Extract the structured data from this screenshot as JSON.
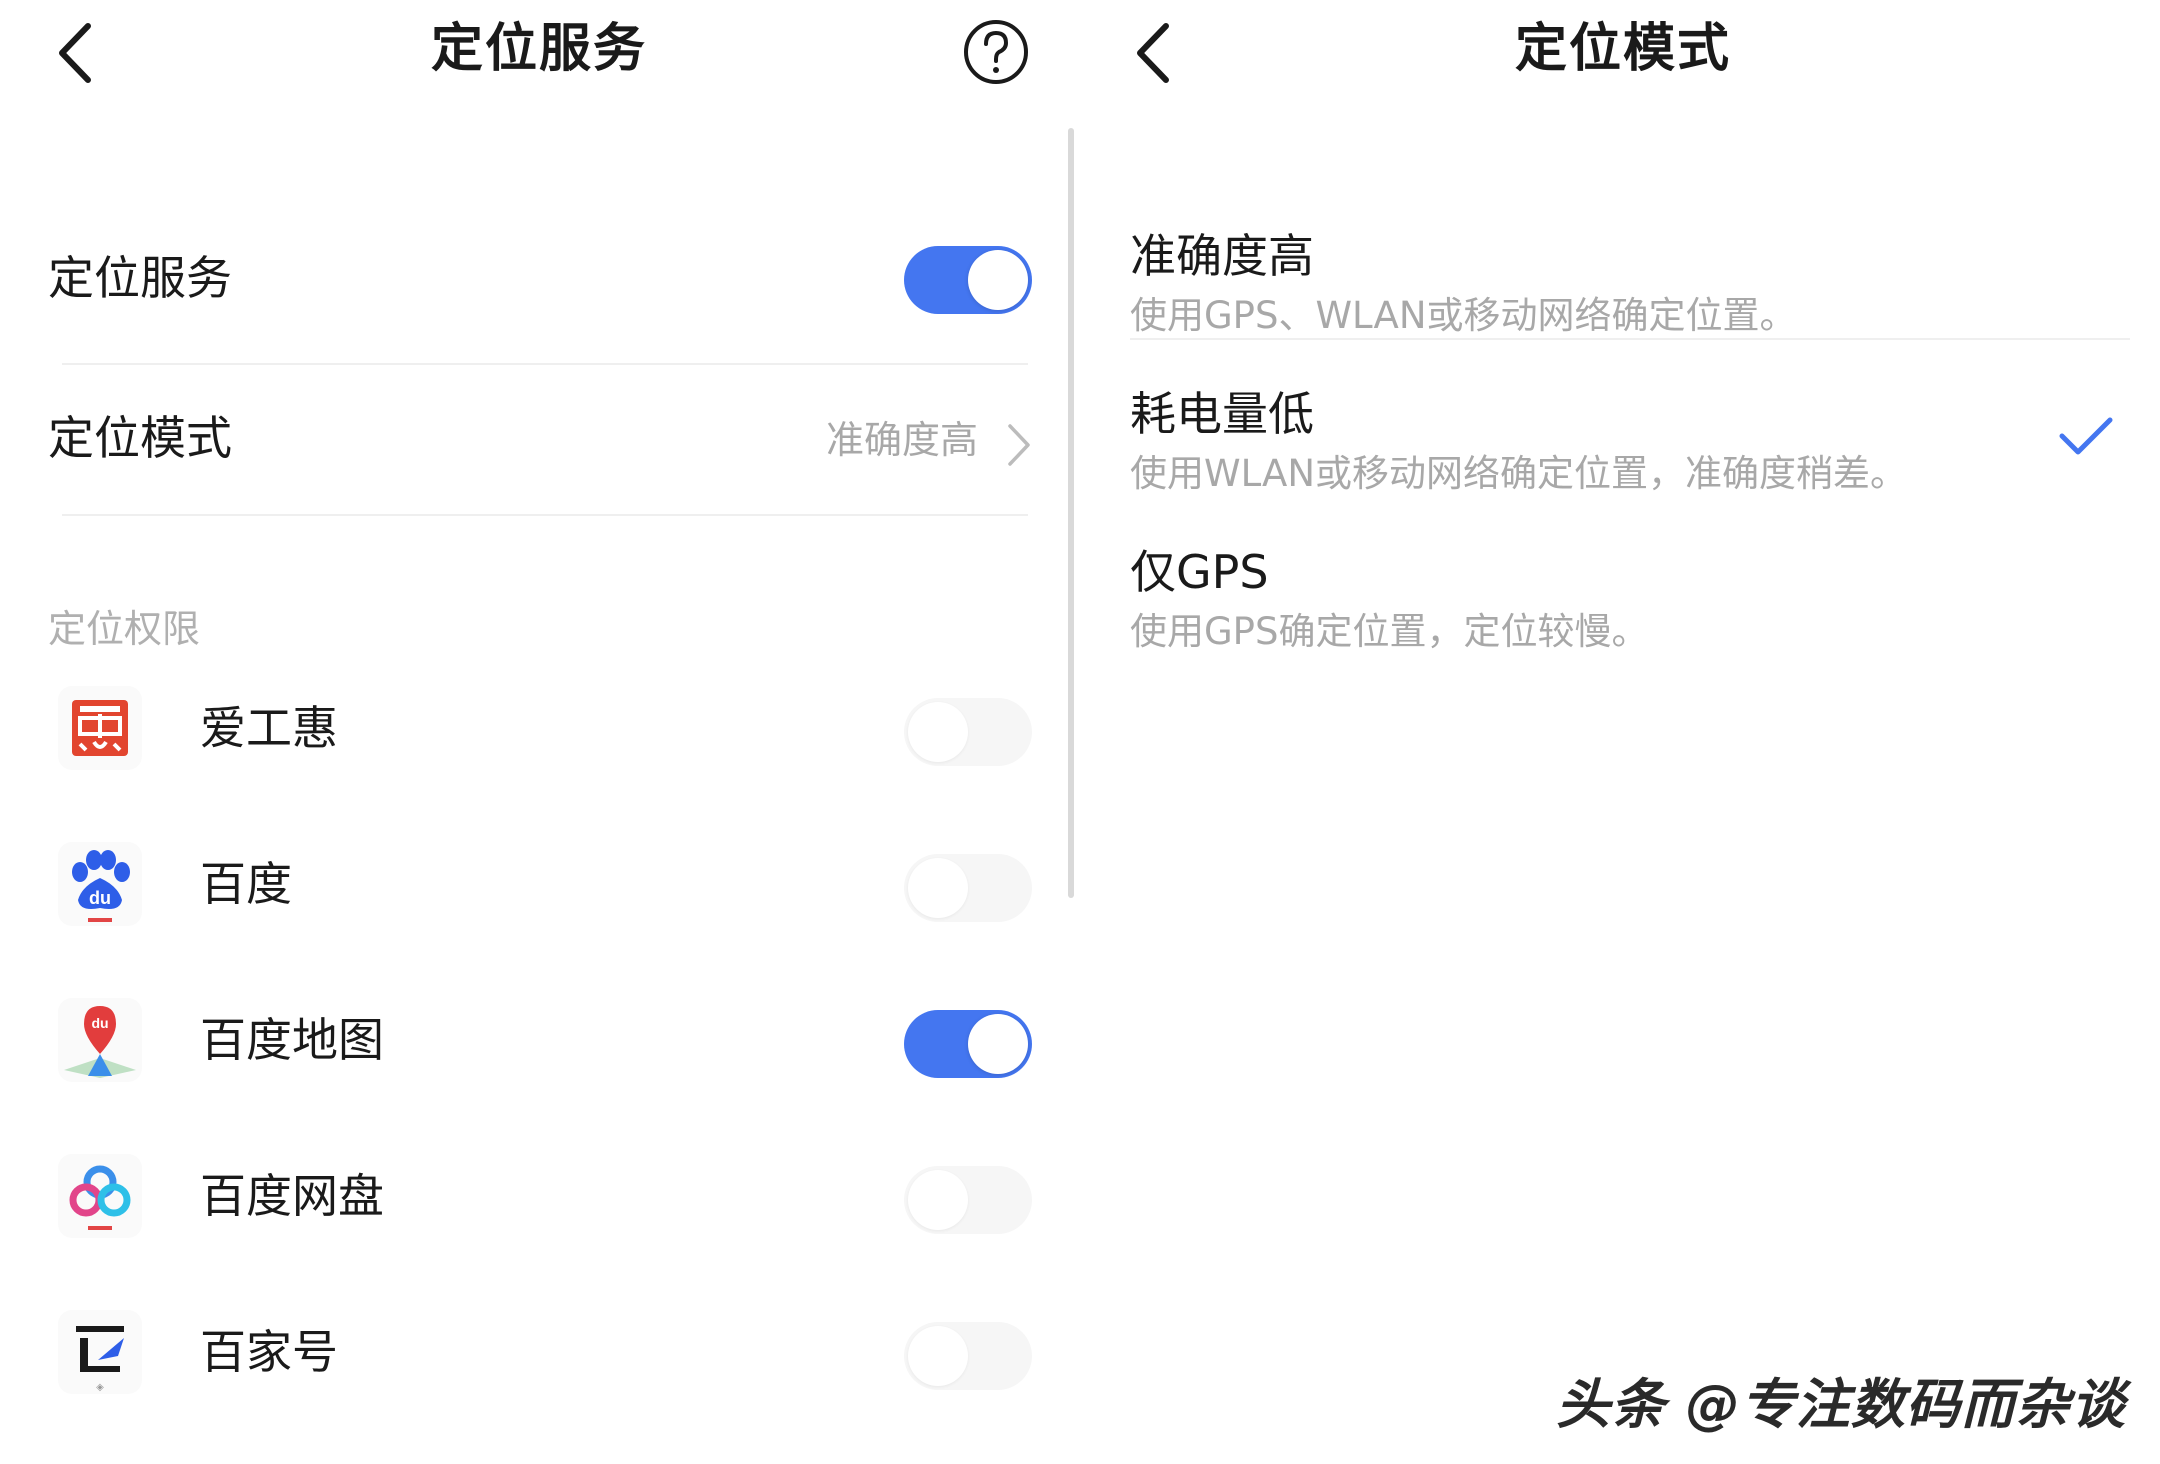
{
  "left_screen": {
    "title": "定位服务",
    "location_service": {
      "label": "定位服务",
      "enabled": true
    },
    "location_mode": {
      "label": "定位模式",
      "value": "准确度高"
    },
    "permissions_header": "定位权限",
    "apps": [
      {
        "name": "爱工惠",
        "icon": "aigonghui-app-icon",
        "enabled": false
      },
      {
        "name": "百度",
        "icon": "baidu-paw-icon",
        "enabled": false
      },
      {
        "name": "百度地图",
        "icon": "baidu-map-pin-icon",
        "enabled": true
      },
      {
        "name": "百度网盘",
        "icon": "baidu-netdisk-cloud-icon",
        "enabled": false
      },
      {
        "name": "百家号",
        "icon": "baijiahao-icon",
        "enabled": false
      }
    ]
  },
  "right_screen": {
    "title": "定位模式",
    "modes": [
      {
        "title": "准确度高",
        "desc": "使用GPS、WLAN或移动网络确定位置。",
        "selected": false
      },
      {
        "title": "耗电量低",
        "desc": "使用WLAN或移动网络确定位置，准确度稍差。",
        "selected": true
      },
      {
        "title": "仅GPS",
        "desc": "使用GPS确定位置，定位较慢。",
        "selected": false
      }
    ]
  },
  "watermark": "头条 @专注数码而杂谈",
  "colors": {
    "accent": "#4476f0",
    "secondary_text": "#a8a8a8",
    "divider": "#efefef"
  }
}
